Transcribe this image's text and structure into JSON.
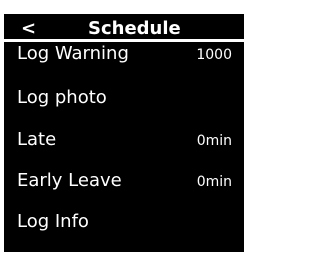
{
  "header": {
    "back_glyph": "<",
    "title": "Schedule"
  },
  "menu": {
    "items": [
      {
        "label": "Log Warning",
        "value": "1000"
      },
      {
        "label": "Log photo",
        "value": ""
      },
      {
        "label": "Late",
        "value": "0min"
      },
      {
        "label": "Early Leave",
        "value": "0min"
      },
      {
        "label": "Log Info",
        "value": ""
      }
    ]
  },
  "colors": {
    "background": "#000000",
    "text": "#ffffff"
  }
}
